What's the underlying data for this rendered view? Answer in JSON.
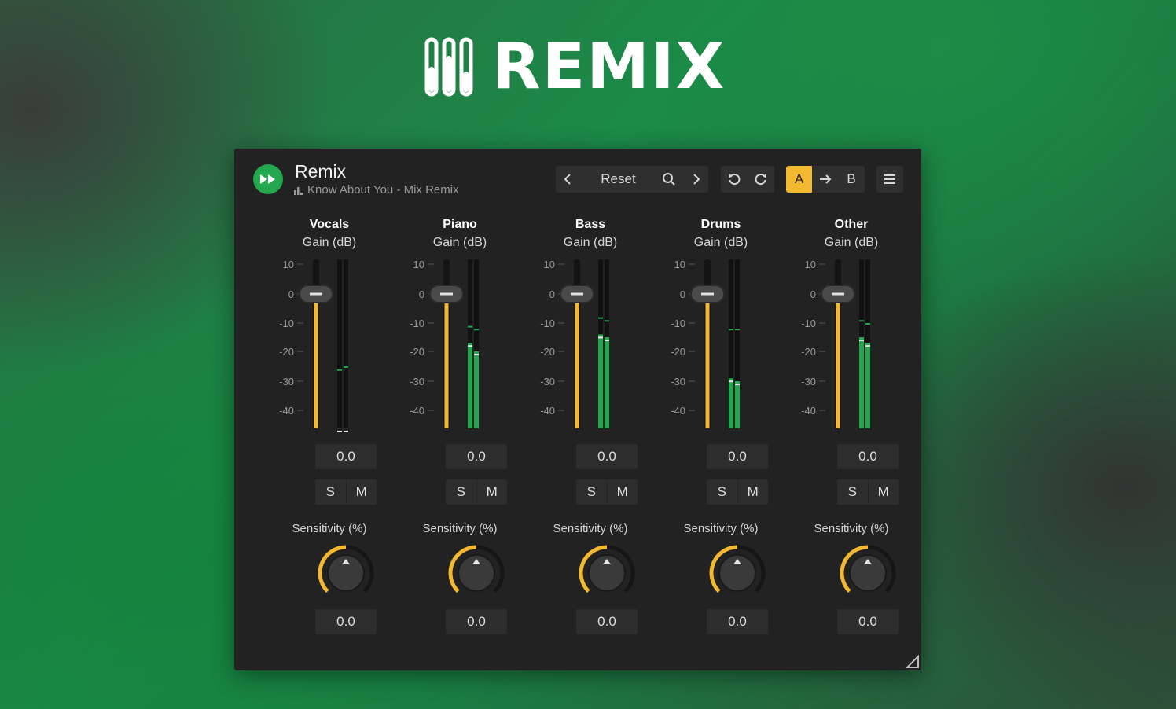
{
  "logo": {
    "text": "REMIX",
    "icon": "sliders-icon"
  },
  "plugin": {
    "title": "Remix",
    "subtitle": "Know About You - Mix Remix",
    "toolbar": {
      "prev_icon": "chevron-left-icon",
      "reset_label": "Reset",
      "search_icon": "search-icon",
      "next_icon": "chevron-right-icon",
      "undo_icon": "undo-icon",
      "redo_icon": "redo-icon",
      "a_label": "A",
      "copy_icon": "arrow-right-icon",
      "b_label": "B",
      "menu_icon": "hamburger-menu-icon"
    },
    "scale_labels": [
      "10",
      "0",
      "-10",
      "-20",
      "-30",
      "-40"
    ],
    "accent_color": "#f2b830",
    "meter_color": "#23a74f",
    "channels": [
      {
        "name": "Vocals",
        "gain_label": "Gain (dB)",
        "gain_value": "0.0",
        "solo_label": "S",
        "mute_label": "M",
        "sensitivity_label": "Sensitivity (%)",
        "sensitivity_value": "0.0",
        "meter_db": [
          -48,
          -48
        ],
        "peak_db": [
          -26,
          -25
        ]
      },
      {
        "name": "Piano",
        "gain_label": "Gain (dB)",
        "gain_value": "0.0",
        "solo_label": "S",
        "mute_label": "M",
        "sensitivity_label": "Sensitivity (%)",
        "sensitivity_value": "0.0",
        "meter_db": [
          -17,
          -20
        ],
        "peak_db": [
          -11,
          -12
        ]
      },
      {
        "name": "Bass",
        "gain_label": "Gain (dB)",
        "gain_value": "0.0",
        "solo_label": "S",
        "mute_label": "M",
        "sensitivity_label": "Sensitivity (%)",
        "sensitivity_value": "0.0",
        "meter_db": [
          -14,
          -15
        ],
        "peak_db": [
          -8,
          -9
        ]
      },
      {
        "name": "Drums",
        "gain_label": "Gain (dB)",
        "gain_value": "0.0",
        "solo_label": "S",
        "mute_label": "M",
        "sensitivity_label": "Sensitivity (%)",
        "sensitivity_value": "0.0",
        "meter_db": [
          -29,
          -30
        ],
        "peak_db": [
          -12,
          -12
        ]
      },
      {
        "name": "Other",
        "gain_label": "Gain (dB)",
        "gain_value": "0.0",
        "solo_label": "S",
        "mute_label": "M",
        "sensitivity_label": "Sensitivity (%)",
        "sensitivity_value": "0.0",
        "meter_db": [
          -15,
          -17
        ],
        "peak_db": [
          -9,
          -10
        ]
      }
    ]
  }
}
